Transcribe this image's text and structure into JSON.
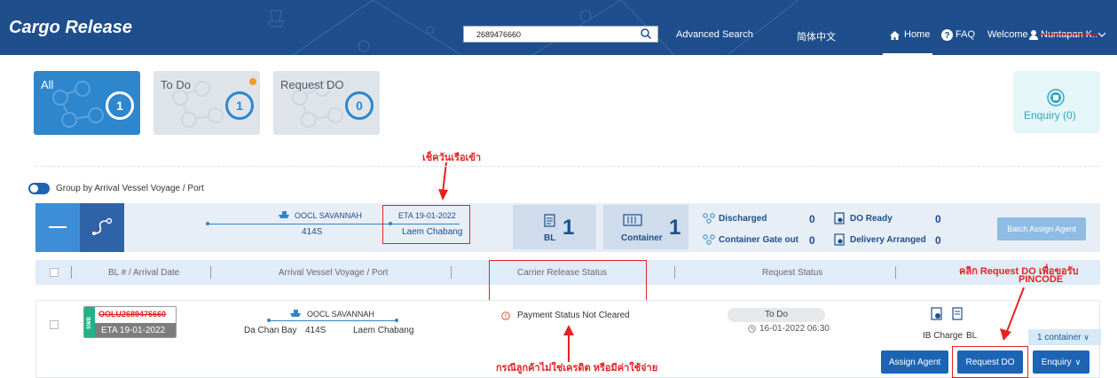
{
  "header": {
    "title": "Cargo Release",
    "search_value": "2689476660",
    "advanced_search": "Advanced Search",
    "language": "简体中文",
    "home": "Home",
    "faq": "FAQ",
    "welcome": "Welcome",
    "user_name": "Nuntapan K.."
  },
  "tabs": [
    {
      "label": "All",
      "count": "1"
    },
    {
      "label": "To Do",
      "count": "1"
    },
    {
      "label": "Request DO",
      "count": "0"
    }
  ],
  "enquiry": {
    "label": "Enquiry (0)"
  },
  "annotations": {
    "vessel_arrival": "เช็ควันเรือเข้า",
    "request_do_note_1": "คลิก Request DO เพื่อขอรับ",
    "request_do_note_2": "PINCODE",
    "payment_note": "กรณีลูกค้าไม่ใช่เครดิต หรือมีค่าใช้จ่าย"
  },
  "group_toggle": {
    "label": "Group by Arrival Vessel Voyage / Port"
  },
  "voyage_group": {
    "vessel": "OOCL SAVANNAH",
    "voyage": "414S",
    "eta": "ETA 19-01-2022",
    "port": "Laem Chabang",
    "bl_count": "1",
    "bl_label": "BL",
    "container_count": "1",
    "container_label": "Container",
    "discharged_label": "Discharged",
    "discharged_count": "0",
    "gate_out_label": "Container Gate out",
    "gate_out_count": "0",
    "do_ready_label": "DO Ready",
    "do_ready_count": "0",
    "delivery_label": "Delivery Arranged",
    "delivery_count": "0",
    "batch_assign": "Batch Assign Agent"
  },
  "columns": {
    "bl": "BL # / Arrival Date",
    "vessel": "Arrival Vessel Voyage / Port",
    "carrier_status": "Carrier Release Status",
    "request_status": "Request Status"
  },
  "row": {
    "bl_type": "SWB",
    "bl_number": "OOLU2689476660",
    "eta": "ETA 19-01-2022",
    "vessel": "OOCL SAVANNAH",
    "origin": "Da Chan Bay",
    "voyage": "414S",
    "destination": "Laem Chabang",
    "carrier_status": "Payment Status Not Cleared",
    "request_status": "To Do",
    "request_time": "16-01-2022 06:30",
    "ib_charge": "IB Charge",
    "bl_link": "BL",
    "containers": "1 container",
    "assign_agent": "Assign Agent",
    "request_do": "Request DO",
    "enquiry": "Enquiry"
  },
  "colors": {
    "header_bg": "#1e4e8c",
    "accent": "#2e86cc",
    "annotation": "#e52222",
    "swb": "#21b28a"
  }
}
